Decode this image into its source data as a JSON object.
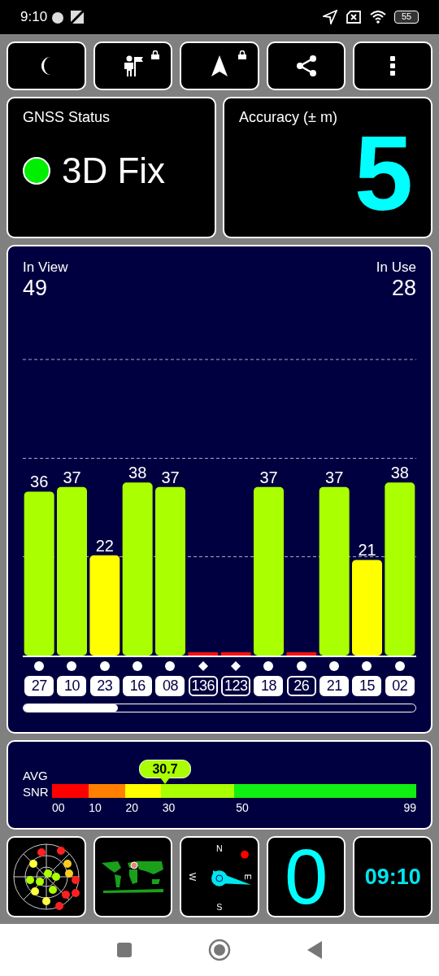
{
  "status_bar": {
    "time": "9:10",
    "battery": "55"
  },
  "toolbar": [
    {
      "kind": "moon",
      "locked": false
    },
    {
      "kind": "person-flag",
      "locked": true
    },
    {
      "kind": "arrow",
      "locked": true
    },
    {
      "kind": "share",
      "locked": false
    },
    {
      "kind": "more",
      "locked": false
    }
  ],
  "gnss_status": {
    "title": "GNSS Status",
    "fixed": true,
    "value": "3D Fix"
  },
  "accuracy": {
    "title": "Accuracy (± m)",
    "value": "5"
  },
  "satellites_panel": {
    "in_view_label": "In View",
    "in_view": "49",
    "in_use_label": "In Use",
    "in_use": "28",
    "chart_data": {
      "type": "bar",
      "categories": [
        "27",
        "10",
        "23",
        "16",
        "08",
        "136",
        "123",
        "18",
        "26",
        "21",
        "15",
        "02"
      ],
      "values": [
        36,
        37,
        22,
        38,
        37,
        0,
        0,
        37,
        0,
        37,
        21,
        38
      ],
      "value_labels": [
        "36",
        "37",
        "22",
        "38",
        "37",
        null,
        null,
        "37",
        null,
        "37",
        "21",
        "38"
      ]
    },
    "satellites": [
      {
        "kind": "circle",
        "in_use": true
      },
      {
        "kind": "circle",
        "in_use": true
      },
      {
        "kind": "circle",
        "in_use": true
      },
      {
        "kind": "circle",
        "in_use": true
      },
      {
        "kind": "circle",
        "in_use": true
      },
      {
        "kind": "diamond",
        "in_use": false
      },
      {
        "kind": "diamond",
        "in_use": false
      },
      {
        "kind": "circle",
        "in_use": true
      },
      {
        "kind": "circle",
        "in_use": false
      },
      {
        "kind": "circle",
        "in_use": true
      },
      {
        "kind": "circle",
        "in_use": true
      },
      {
        "kind": "circle",
        "in_use": true
      }
    ]
  },
  "snr_panel": {
    "label_1": "AVG",
    "label_2": "SNR",
    "value": "30.7",
    "level": 0.31,
    "ticks": [
      "00",
      "10",
      "20",
      "30",
      "50",
      "99"
    ]
  },
  "tiles": {
    "compass": [
      "N",
      "E",
      "S",
      "W"
    ],
    "speed": "0",
    "clock": "09:10"
  }
}
